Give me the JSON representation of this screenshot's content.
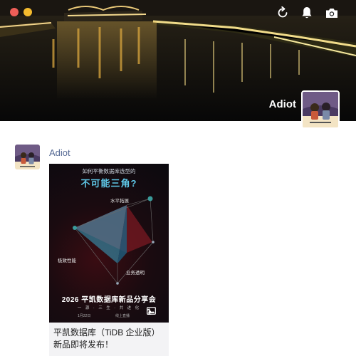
{
  "window": {
    "controls": [
      "close",
      "minimize"
    ]
  },
  "toolbar": {
    "refresh_icon": "refresh-icon",
    "notification_icon": "bell-icon",
    "camera_icon": "camera-icon"
  },
  "profile": {
    "name": "Adiot"
  },
  "post": {
    "author": "Adiot",
    "image": {
      "question": "如何平衡数据库选型的",
      "headline": "不可能三角?",
      "labels": {
        "top": "水平拓展",
        "left": "极致性能",
        "right": "业务透明"
      },
      "event_title": "2026 平凯数据库新品分享会",
      "event_subtitle": "一 源 · 三 生 · 共 进 化",
      "date": "1月22日",
      "live": "线上直播",
      "image_count": "1"
    },
    "caption": "平凯数据库（TiDB 企业版）新品即将发布！"
  },
  "colors": {
    "author_link": "#576b95",
    "headline": "#5fc8e8",
    "caption_bg": "#f3f3f5"
  }
}
